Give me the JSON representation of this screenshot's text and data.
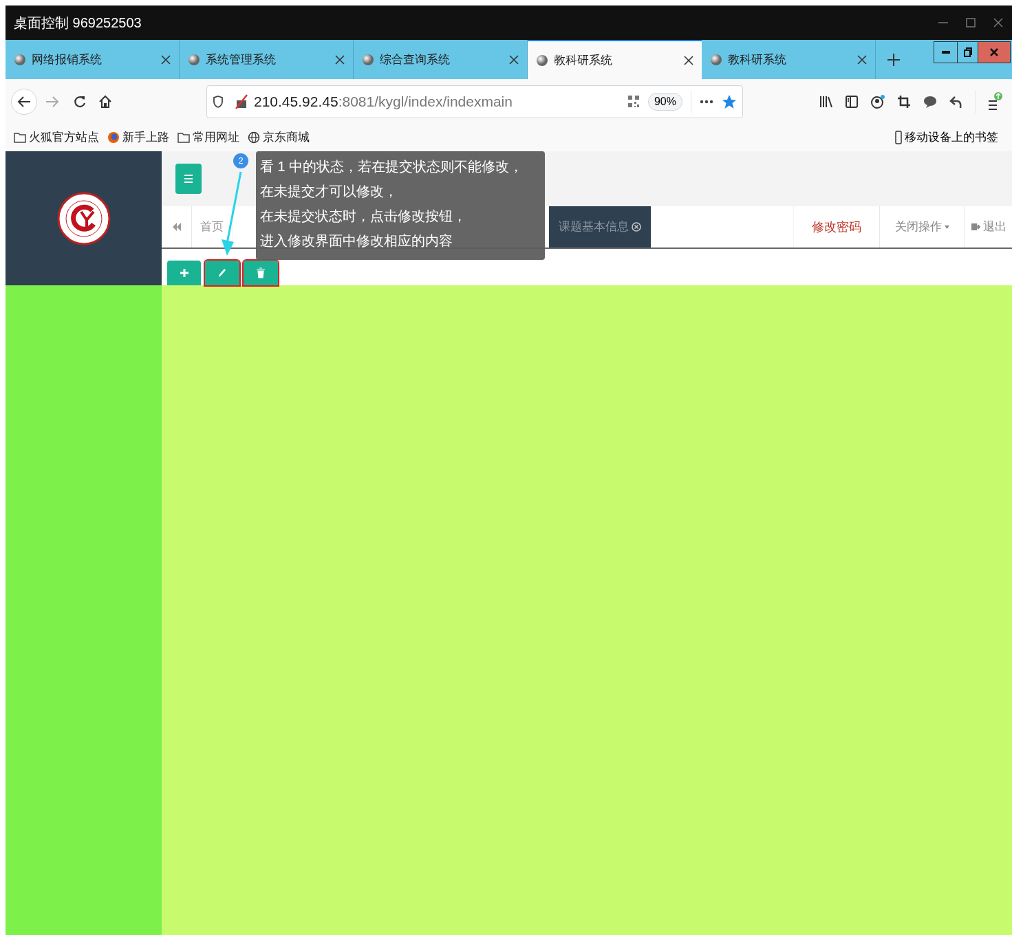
{
  "remote_title": "桌面控制 969252503",
  "tabs": [
    {
      "label": "网络报销系统",
      "selected": false
    },
    {
      "label": "系统管理系统",
      "selected": false
    },
    {
      "label": "综合查询系统",
      "selected": false
    },
    {
      "label": "教科研系统",
      "selected": true
    },
    {
      "label": "教科研系统",
      "selected": false
    }
  ],
  "address": {
    "host": "210.45.92.45",
    "path": ":8081/kygl/index/indexmain"
  },
  "zoom": "90%",
  "bookmarks": [
    {
      "label": "火狐官方站点",
      "kind": "folder"
    },
    {
      "label": "新手上路",
      "kind": "firefox"
    },
    {
      "label": "常用网址",
      "kind": "folder"
    },
    {
      "label": "京东商城",
      "kind": "globe"
    }
  ],
  "mobile_bookmarks": "移动设备上的书签",
  "app": {
    "nav_tabs": [
      {
        "label": "首页",
        "selected": false
      },
      {
        "label": "课题基本信息",
        "selected": true
      }
    ],
    "change_password": "修改密码",
    "close_ops": "关闭操作",
    "logout": "退出"
  },
  "callout": {
    "step": "2",
    "lines": [
      "看 1 中的状态，若在提交状态则不能修改，",
      "在未提交才可以修改，",
      "在未提交状态时，点击修改按钮，",
      "进入修改界面中修改相应的内容"
    ]
  }
}
